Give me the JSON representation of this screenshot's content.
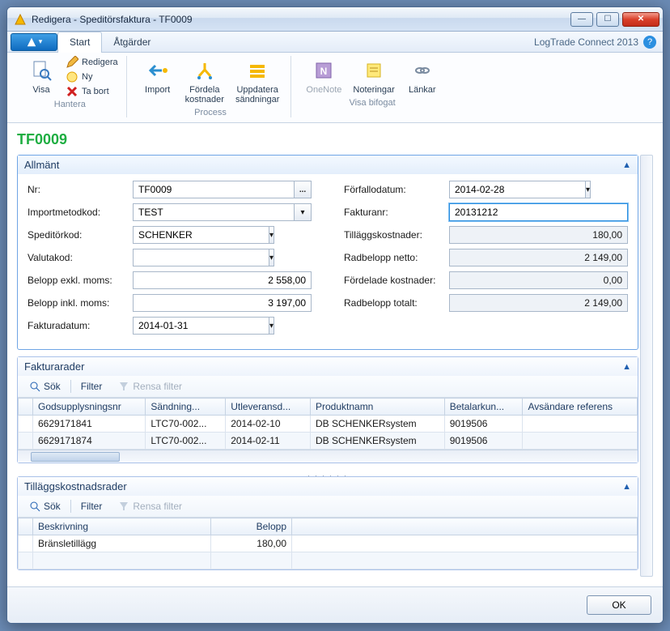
{
  "window": {
    "title": "Redigera - Speditörsfaktura - TF0009"
  },
  "brand": "LogTrade Connect 2013",
  "tabs": {
    "start": "Start",
    "actions": "Åtgärder"
  },
  "ribbon": {
    "visa": "Visa",
    "redigera": "Redigera",
    "ny": "Ny",
    "tabort": "Ta bort",
    "hantera": "Hantera",
    "import": "Import",
    "fordela": "Fördela\nkostnader",
    "uppdatera": "Uppdatera\nsändningar",
    "process": "Process",
    "onenote": "OneNote",
    "noteringar": "Noteringar",
    "lankar": "Länkar",
    "visabifogat": "Visa bifogat"
  },
  "docTitle": "TF0009",
  "sections": {
    "allmant": "Allmänt",
    "fakturarader": "Fakturarader",
    "tillagg": "Tilläggskostnadsrader"
  },
  "form": {
    "labels": {
      "nr": "Nr:",
      "importmetodkod": "Importmetodkod:",
      "speditorkod": "Speditörkod:",
      "valutakod": "Valutakod:",
      "beloppexkl": "Belopp exkl. moms:",
      "beloppinkl": "Belopp inkl. moms:",
      "fakturadatum": "Fakturadatum:",
      "forfallodatum": "Förfallodatum:",
      "fakturanr": "Fakturanr:",
      "tillaggskostnader": "Tilläggskostnader:",
      "radbeloppnetto": "Radbelopp netto:",
      "fordelade": "Fördelade kostnader:",
      "radbelopptotalt": "Radbelopp totalt:"
    },
    "values": {
      "nr": "TF0009",
      "importmetodkod": "TEST",
      "speditorkod": "SCHENKER",
      "valutakod": "",
      "beloppexkl": "2 558,00",
      "beloppinkl": "3 197,00",
      "fakturadatum": "2014-01-31",
      "forfallodatum": "2014-02-28",
      "fakturanr": "20131212",
      "tillaggskostnader": "180,00",
      "radbeloppnetto": "2 149,00",
      "fordelade": "0,00",
      "radbelopptotalt": "2 149,00"
    }
  },
  "toolbar": {
    "sok": "Sök",
    "filter": "Filter",
    "rensa": "Rensa filter"
  },
  "grid1": {
    "headers": {
      "gods": "Godsupplysningsnr",
      "sandning": "Sändning...",
      "utleverans": "Utleveransd...",
      "produkt": "Produktnamn",
      "betalar": "Betalarkun...",
      "avsandare": "Avsändare referens"
    },
    "rows": [
      {
        "gods": "6629171841",
        "sandning": "LTC70-002...",
        "utleverans": "2014-02-10",
        "produkt": "DB SCHENKERsystem",
        "betalar": "9019506",
        "avsandare": ""
      },
      {
        "gods": "6629171874",
        "sandning": "LTC70-002...",
        "utleverans": "2014-02-11",
        "produkt": "DB SCHENKERsystem",
        "betalar": "9019506",
        "avsandare": ""
      }
    ]
  },
  "grid2": {
    "headers": {
      "beskrivning": "Beskrivning",
      "belopp": "Belopp"
    },
    "rows": [
      {
        "beskrivning": "Bränsletillägg",
        "belopp": "180,00"
      }
    ]
  },
  "footer": {
    "ok": "OK"
  }
}
